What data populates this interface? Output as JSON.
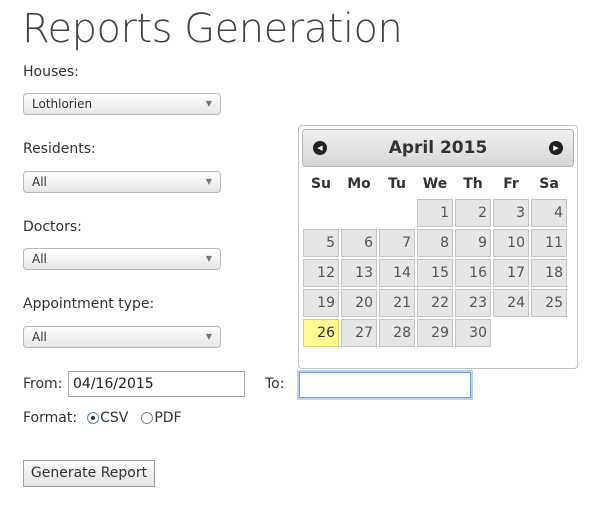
{
  "page": {
    "title": "Reports Generation"
  },
  "form": {
    "houses": {
      "label": "Houses:",
      "value": "Lothlorien"
    },
    "residents": {
      "label": "Residents:",
      "value": "All"
    },
    "doctors": {
      "label": "Doctors:",
      "value": "All"
    },
    "appointment_type": {
      "label": "Appointment type:",
      "value": "All"
    },
    "from": {
      "label": "From:",
      "value": "04/16/2015"
    },
    "to": {
      "label": "To:",
      "value": ""
    },
    "format": {
      "label": "Format:",
      "options": [
        {
          "label": "CSV",
          "checked": true
        },
        {
          "label": "PDF",
          "checked": false
        }
      ]
    },
    "generate_label": "Generate Report"
  },
  "datepicker": {
    "month_title": "April 2015",
    "weekdays": [
      "Su",
      "Mo",
      "Tu",
      "We",
      "Th",
      "Fr",
      "Sa"
    ],
    "today": "26",
    "weeks": [
      [
        "",
        "",
        "",
        "1",
        "2",
        "3",
        "4"
      ],
      [
        "5",
        "6",
        "7",
        "8",
        "9",
        "10",
        "11"
      ],
      [
        "12",
        "13",
        "14",
        "15",
        "16",
        "17",
        "18"
      ],
      [
        "19",
        "20",
        "21",
        "22",
        "23",
        "24",
        "25"
      ],
      [
        "26",
        "27",
        "28",
        "29",
        "30",
        "",
        ""
      ]
    ]
  },
  "icons": {
    "dropdown_arrow": "▼",
    "prev_month": "◀",
    "next_month": "▶"
  }
}
